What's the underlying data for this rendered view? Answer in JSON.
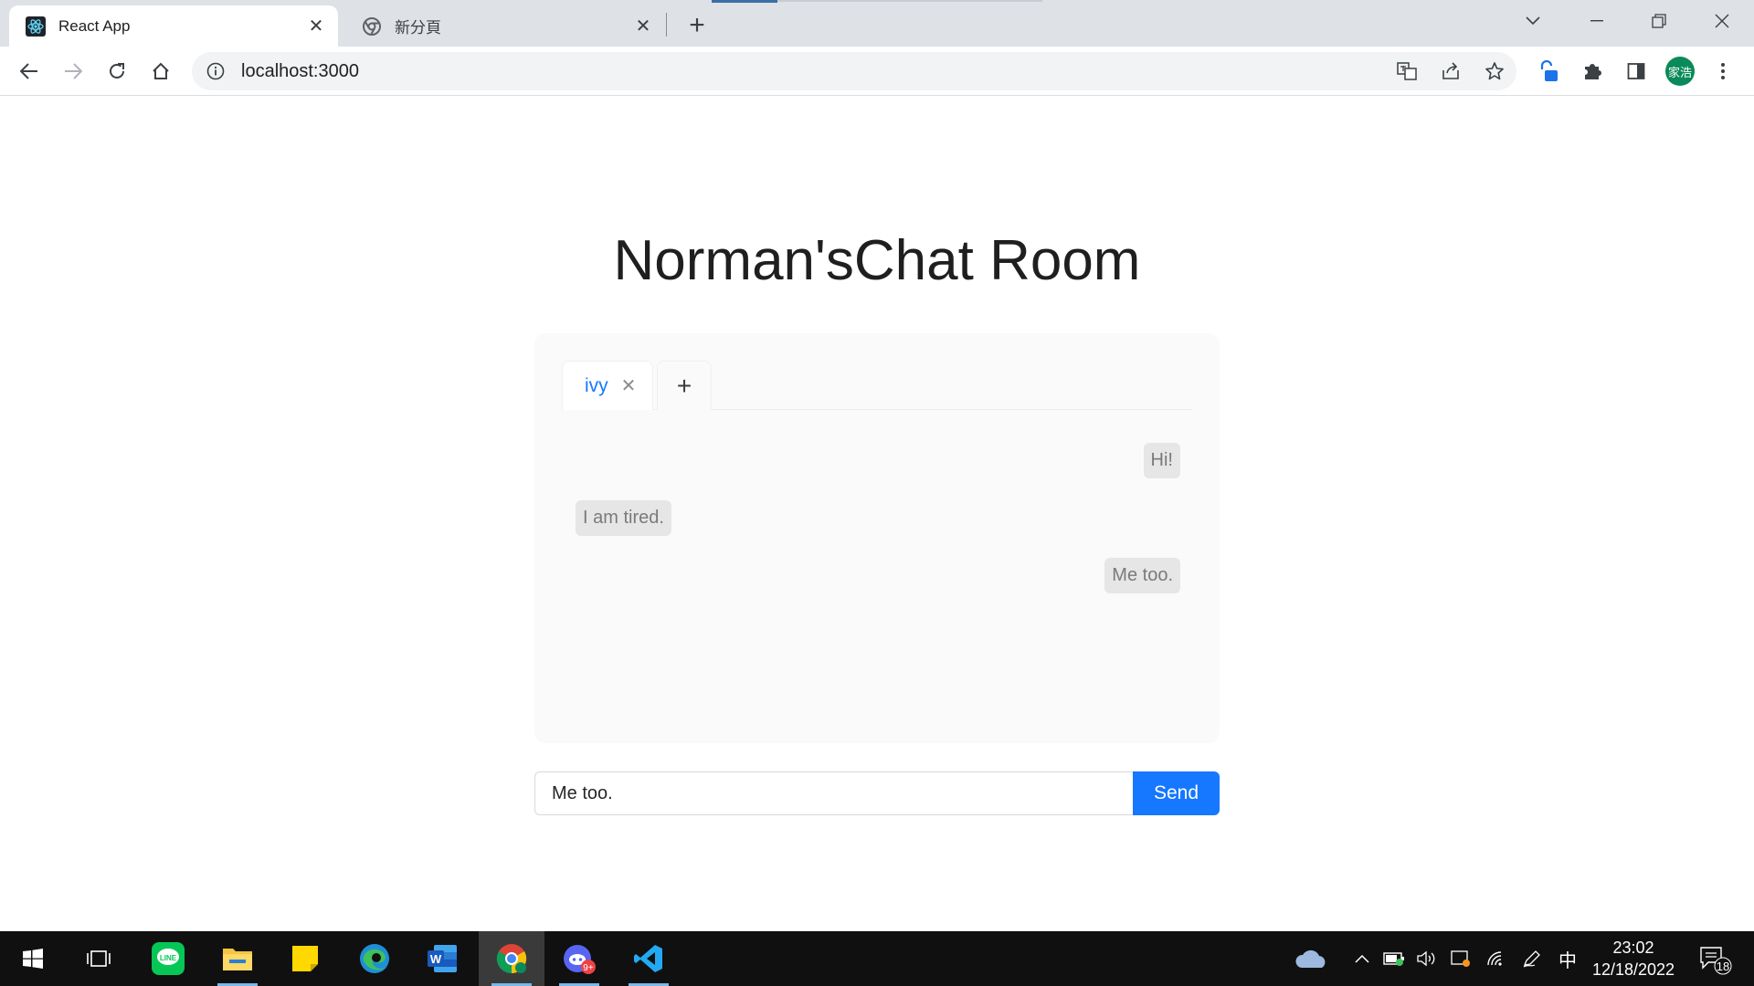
{
  "browser": {
    "tabs": [
      {
        "title": "React App",
        "active": true,
        "icon": "react-icon"
      },
      {
        "title": "新分頁",
        "active": false,
        "icon": "chrome-icon"
      }
    ],
    "close_glyph": "✕",
    "new_tab_glyph": "+",
    "url": "localhost:3000",
    "profile_initials": "家浩"
  },
  "page": {
    "title": "Norman'sChat Room",
    "chat_tabs": [
      {
        "label": "ivy",
        "close_glyph": "✕"
      }
    ],
    "add_tab_glyph": "+",
    "messages": [
      {
        "text": "Hi!",
        "side": "right"
      },
      {
        "text": "I am tired.",
        "side": "left"
      },
      {
        "text": "Me too.",
        "side": "right"
      }
    ],
    "input_value": "Me too.",
    "send_label": "Send"
  },
  "taskbar": {
    "apps": [
      "start-icon",
      "task-view-icon",
      "line-icon",
      "file-explorer-icon",
      "sticky-notes-icon",
      "edge-icon",
      "word-icon",
      "chrome-icon",
      "discord-icon",
      "vscode-icon"
    ],
    "ime_label": "中",
    "time": "23:02",
    "date": "12/18/2022",
    "notification_count": "18",
    "discord_badge": "9+",
    "colors": {
      "accent": "#1677ff",
      "taskbar": "#101010"
    }
  }
}
